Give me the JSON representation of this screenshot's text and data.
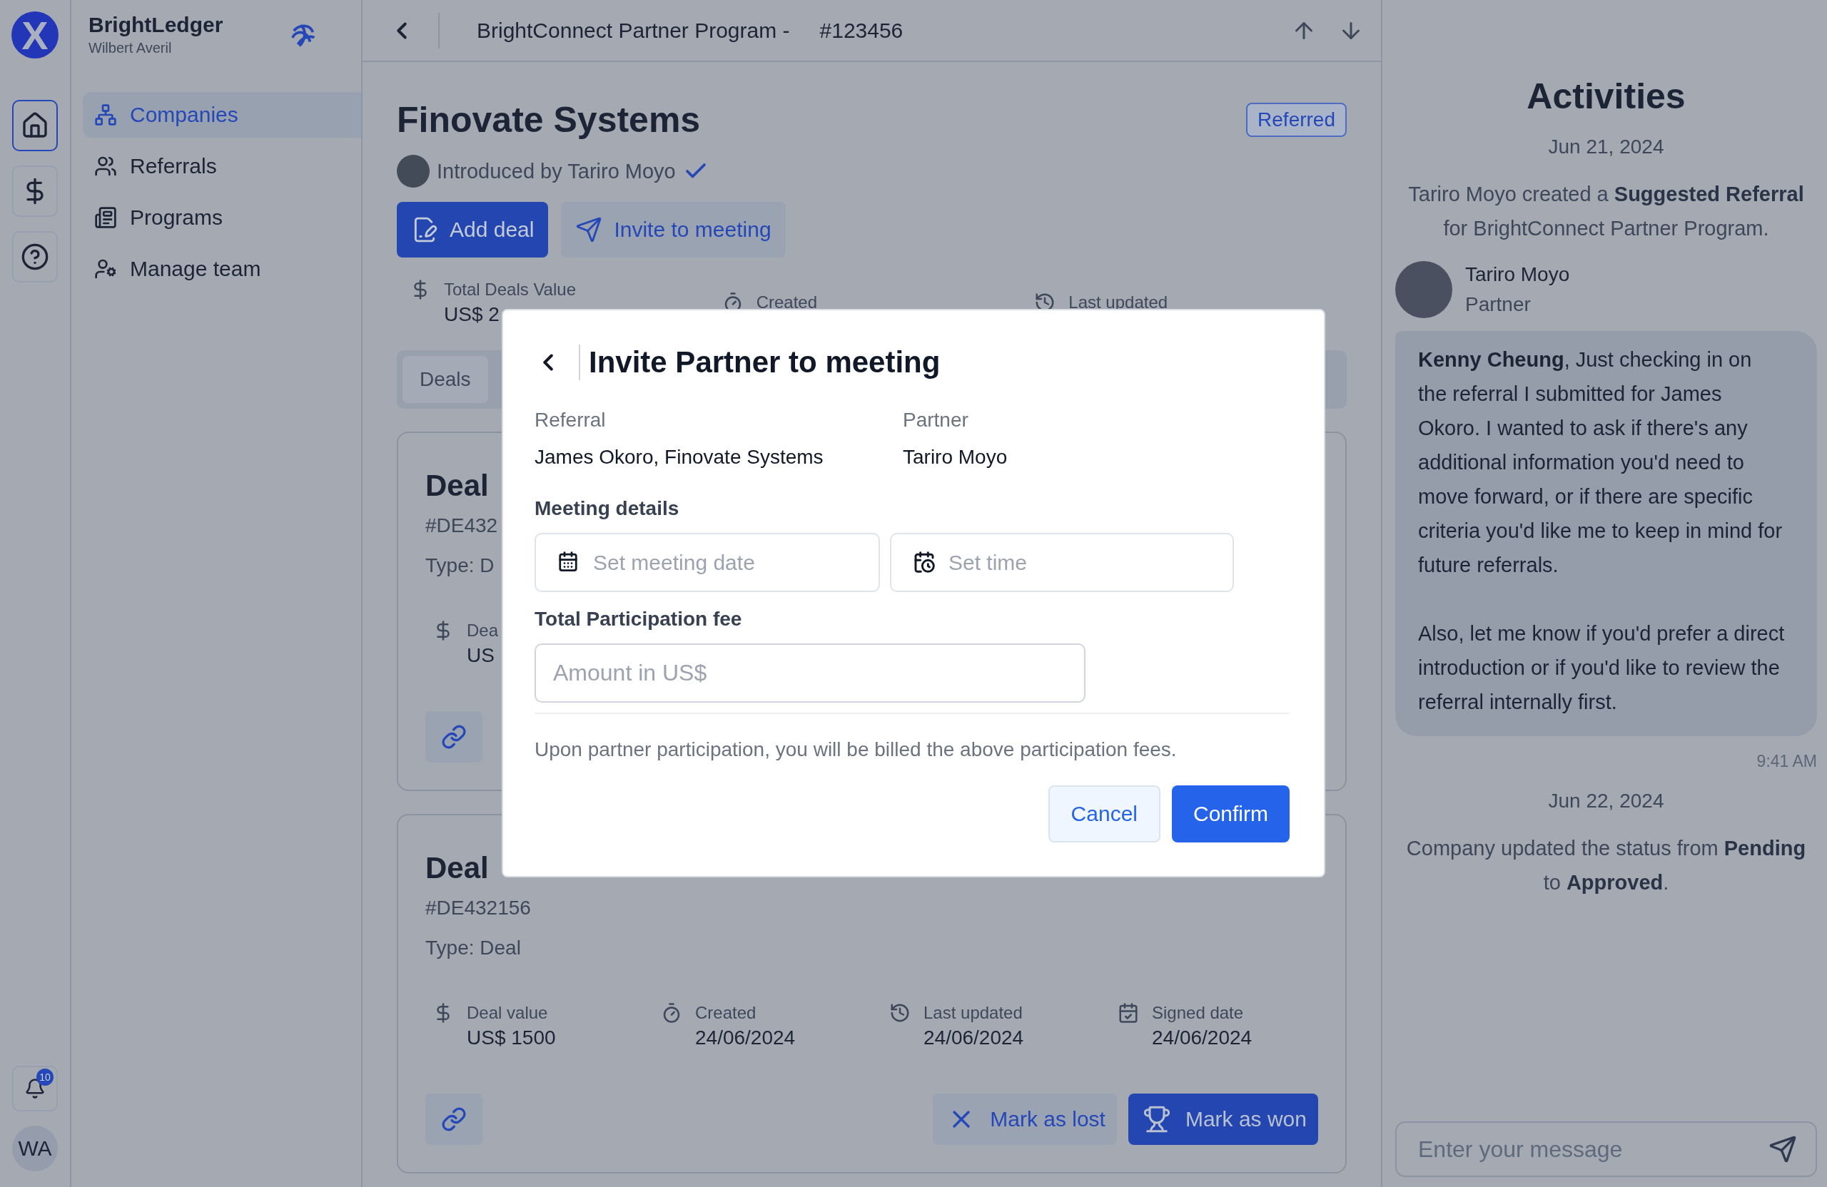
{
  "rail": {
    "logo": "X",
    "items": [
      {
        "kind": "home",
        "selected": true
      },
      {
        "kind": "billing",
        "selected": false
      },
      {
        "kind": "help",
        "selected": false
      }
    ],
    "notifications": "10",
    "avatar": "WA"
  },
  "sidebar": {
    "brand": "BrightLedger",
    "user": "Wilbert Averil",
    "items": [
      {
        "kind": "companies",
        "label": "Companies",
        "selected": true
      },
      {
        "kind": "referrals",
        "label": "Referrals",
        "selected": false
      },
      {
        "kind": "programs",
        "label": "Programs",
        "selected": false
      },
      {
        "kind": "team",
        "label": "Manage team",
        "selected": false
      }
    ]
  },
  "header": {
    "title": "BrightConnect Partner Program -",
    "id": "#123456"
  },
  "company": {
    "name": "Finovate Systems",
    "status": "Referred",
    "introduced_by": "Introduced by Tariro Moyo",
    "verified": true,
    "actions": [
      {
        "kind": "primary",
        "label": "Add deal"
      },
      {
        "kind": "secondary",
        "label": "Invite to meeting"
      }
    ],
    "stats": [
      {
        "kind": "value",
        "label": "Total Deals Value",
        "value": "US$ 2"
      },
      {
        "kind": "created",
        "label": "Created"
      },
      {
        "kind": "updated",
        "label": "Last updated"
      }
    ]
  },
  "tabs": [
    {
      "label": "Deals",
      "selected": true
    }
  ],
  "deals": [
    {
      "title": "Deal",
      "id": "#DE432",
      "type": "Type: D",
      "stats": [
        {
          "kind": "value",
          "label": "Dea",
          "value": "US"
        }
      ]
    },
    {
      "title": "Deal",
      "id": "#DE432156",
      "type": "Type: Deal",
      "stats": [
        {
          "kind": "value",
          "label": "Deal value",
          "value": "US$ 1500"
        },
        {
          "kind": "created",
          "label": "Created",
          "value": "24/06/2024"
        },
        {
          "kind": "updated",
          "label": "Last updated",
          "value": "24/06/2024"
        },
        {
          "kind": "signed",
          "label": "Signed date",
          "value": "24/06/2024"
        }
      ],
      "actions": [
        {
          "kind": "lost",
          "label": "Mark as lost"
        },
        {
          "kind": "won",
          "label": "Mark as won"
        }
      ]
    }
  ],
  "modal": {
    "title": "Invite Partner to meeting",
    "info": [
      {
        "label": "Referral",
        "value": "James Okoro, Finovate Systems"
      },
      {
        "label": "Partner",
        "value": "Tariro Moyo"
      }
    ],
    "meeting_label": "Meeting details",
    "date_placeholder": "Set meeting date",
    "time_placeholder": "Set time",
    "fee_label": "Total Participation fee",
    "fee_placeholder": "Amount in US$",
    "note": "Upon partner participation, you will be billed the above participation fees.",
    "cancel": "Cancel",
    "confirm": "Confirm"
  },
  "activities": {
    "title": "Activities",
    "entries": [
      {
        "kind": "event",
        "date": "Jun 21, 2024",
        "text": "Tariro Moyo created a **Suggested Referral** for BrightConnect Partner Program."
      },
      {
        "kind": "message",
        "author": "Tariro Moyo",
        "role": "Partner",
        "paragraphs": [
          "**Kenny Cheung**, Just checking in on the referral I submitted for James Okoro. I wanted to ask if there's any additional information you'd need to move forward, or if there are specific criteria you'd like me to keep in mind for future referrals.",
          "Also, let me know if you'd prefer a direct introduction or if you'd like to review the referral internally first."
        ],
        "time": "9:41 AM"
      },
      {
        "kind": "event",
        "date": "Jun 22, 2024",
        "text": "Company updated the status from **Pending** to **Approved**."
      }
    ],
    "input_placeholder": "Enter your message"
  }
}
